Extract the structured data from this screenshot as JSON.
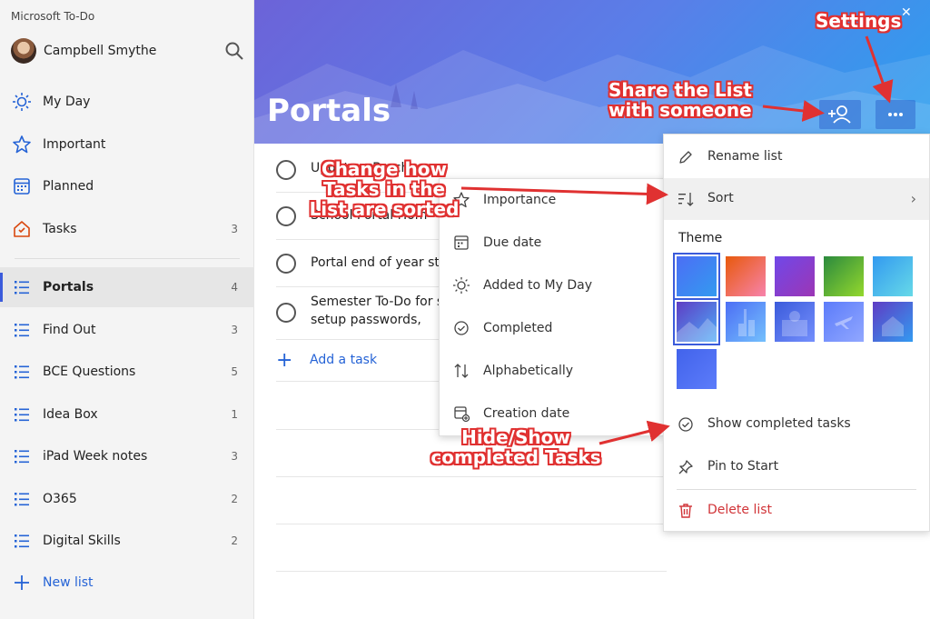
{
  "app": {
    "title": "Microsoft To-Do"
  },
  "user": {
    "name": "Campbell Smythe"
  },
  "sidebar": {
    "items": [
      {
        "label": "My Day",
        "count": ""
      },
      {
        "label": "Important",
        "count": ""
      },
      {
        "label": "Planned",
        "count": ""
      },
      {
        "label": "Tasks",
        "count": "3"
      }
    ],
    "lists": [
      {
        "label": "Portals",
        "count": "4"
      },
      {
        "label": "Find Out",
        "count": "3"
      },
      {
        "label": "BCE Questions",
        "count": "5"
      },
      {
        "label": "Idea Box",
        "count": "1"
      },
      {
        "label": "iPad Week notes",
        "count": "3"
      },
      {
        "label": "O365",
        "count": "2"
      },
      {
        "label": "Digital Skills",
        "count": "2"
      }
    ],
    "new_list": "New list"
  },
  "main": {
    "title": "Portals",
    "tasks": [
      "Update a Brochure",
      "School Portal Hom",
      "Portal end of year sta",
      "Semester To-Do for se"
    ],
    "task4_line2": "setup passwords,",
    "add_task": "Add a task"
  },
  "sort_menu": {
    "items": [
      "Importance",
      "Due date",
      "Added to My Day",
      "Completed",
      "Alphabetically",
      "Creation date"
    ]
  },
  "settings_menu": {
    "rename": "Rename list",
    "sort": "Sort",
    "theme": "Theme",
    "show_completed": "Show completed tasks",
    "pin": "Pin to Start",
    "delete": "Delete list"
  },
  "annotations": {
    "settings": "Settings",
    "share_line1": "Share the List",
    "share_line2": "with someone",
    "sort_line1": "Change how",
    "sort_line2": "Tasks in the",
    "sort_line3": "List are sorted",
    "hide_line1": "Hide/Show",
    "hide_line2": "completed Tasks"
  },
  "colors": {
    "accent": "#3b5bdb",
    "link": "#2563d6",
    "delete": "#d13438",
    "annotation": "#e03131"
  }
}
